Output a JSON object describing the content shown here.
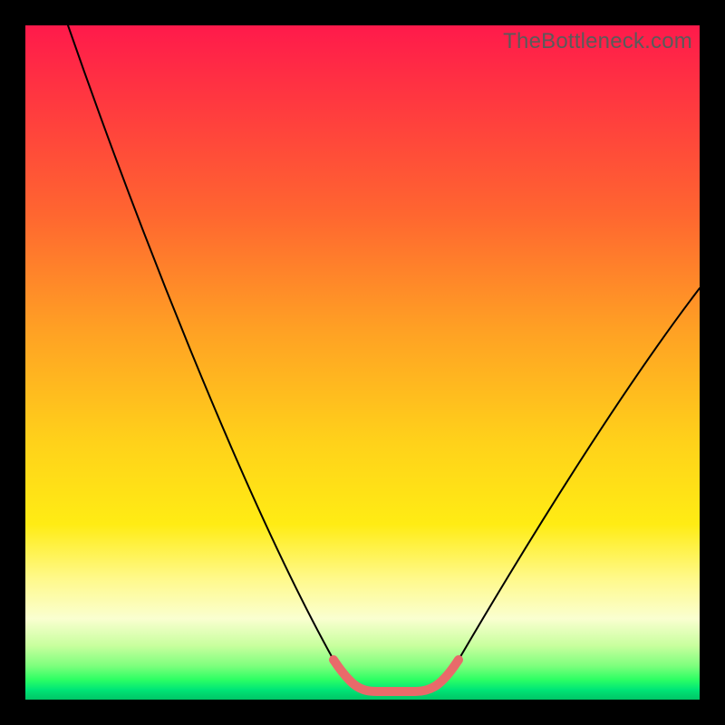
{
  "watermark": "TheBottleneck.com",
  "colors": {
    "frame": "#000000",
    "curve": "#000000",
    "accent": "#e96a6a",
    "gradient_stops": [
      "#ff1a4b",
      "#ff3a3f",
      "#ff6630",
      "#ffa024",
      "#ffd21a",
      "#ffec14",
      "#fff98a",
      "#faffd0",
      "#c8ff9e",
      "#7dff7d",
      "#2eff64",
      "#00e676",
      "#00c566"
    ]
  },
  "chart_data": {
    "type": "line",
    "title": "",
    "xlabel": "",
    "ylabel": "",
    "xlim": [
      0,
      100
    ],
    "ylim": [
      0,
      100
    ],
    "grid": false,
    "x": [
      0,
      5,
      10,
      15,
      20,
      25,
      30,
      35,
      40,
      45,
      48,
      50,
      52,
      54,
      56,
      58,
      60,
      65,
      70,
      75,
      80,
      85,
      90,
      95,
      100
    ],
    "series": [
      {
        "name": "bottleneck-curve",
        "values": [
          100,
          90,
          80,
          70,
          60,
          50,
          40,
          30,
          20,
          10,
          4,
          1,
          0,
          0,
          0,
          1,
          3,
          10,
          20,
          30,
          40,
          48,
          55,
          60,
          64
        ]
      }
    ],
    "accent_region_x": [
      45,
      60
    ],
    "annotations": [
      {
        "text": "TheBottleneck.com",
        "position": "top-right"
      }
    ]
  }
}
